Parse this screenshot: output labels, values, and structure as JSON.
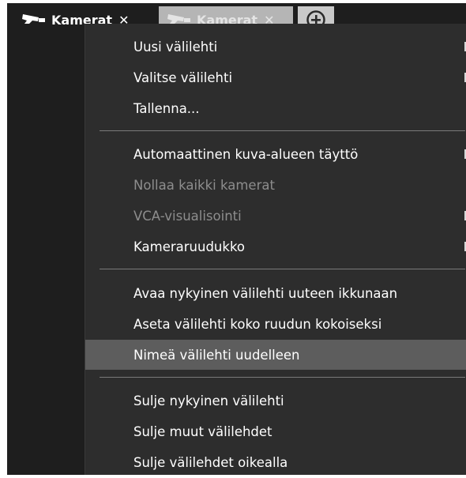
{
  "tabs": [
    {
      "label": "Kamerat",
      "icon": "camera-icon",
      "close": "✕",
      "active": true
    },
    {
      "label": "Kamerat",
      "icon": "camera-icon",
      "close": "✕",
      "active": false
    }
  ],
  "add_tab_icon": "plus-circle-icon",
  "menu": {
    "items": [
      {
        "label": "Uusi välilehti",
        "enabled": true,
        "submenu": true
      },
      {
        "label": "Valitse välilehti",
        "enabled": true,
        "submenu": true
      },
      {
        "label": "Tallenna...",
        "enabled": true,
        "submenu": false
      },
      {
        "label": "Automaattinen kuva-alueen täyttö",
        "enabled": true,
        "submenu": true
      },
      {
        "label": "Nollaa kaikki kamerat",
        "enabled": false,
        "submenu": false
      },
      {
        "label": "VCA-visualisointi",
        "enabled": false,
        "submenu": true
      },
      {
        "label": "Kameraruudukko",
        "enabled": true,
        "submenu": true
      },
      {
        "label": "Avaa nykyinen välilehti uuteen ikkunaan",
        "enabled": true,
        "submenu": false
      },
      {
        "label": "Aseta välilehti koko ruudun kokoiseksi",
        "enabled": true,
        "submenu": false
      },
      {
        "label": "Nimeä välilehti uudelleen",
        "enabled": true,
        "submenu": false,
        "highlighted": true
      },
      {
        "label": "Sulje nykyinen välilehti",
        "enabled": true,
        "submenu": false
      },
      {
        "label": "Sulje muut välilehdet",
        "enabled": true,
        "submenu": false
      },
      {
        "label": "Sulje välilehdet oikealla",
        "enabled": true,
        "submenu": false
      }
    ]
  },
  "colors": {
    "background": "#1e1e1e",
    "menu": "#2d2d2d",
    "highlight": "#5d5d5d",
    "disabled_text": "#8d8d8d"
  }
}
